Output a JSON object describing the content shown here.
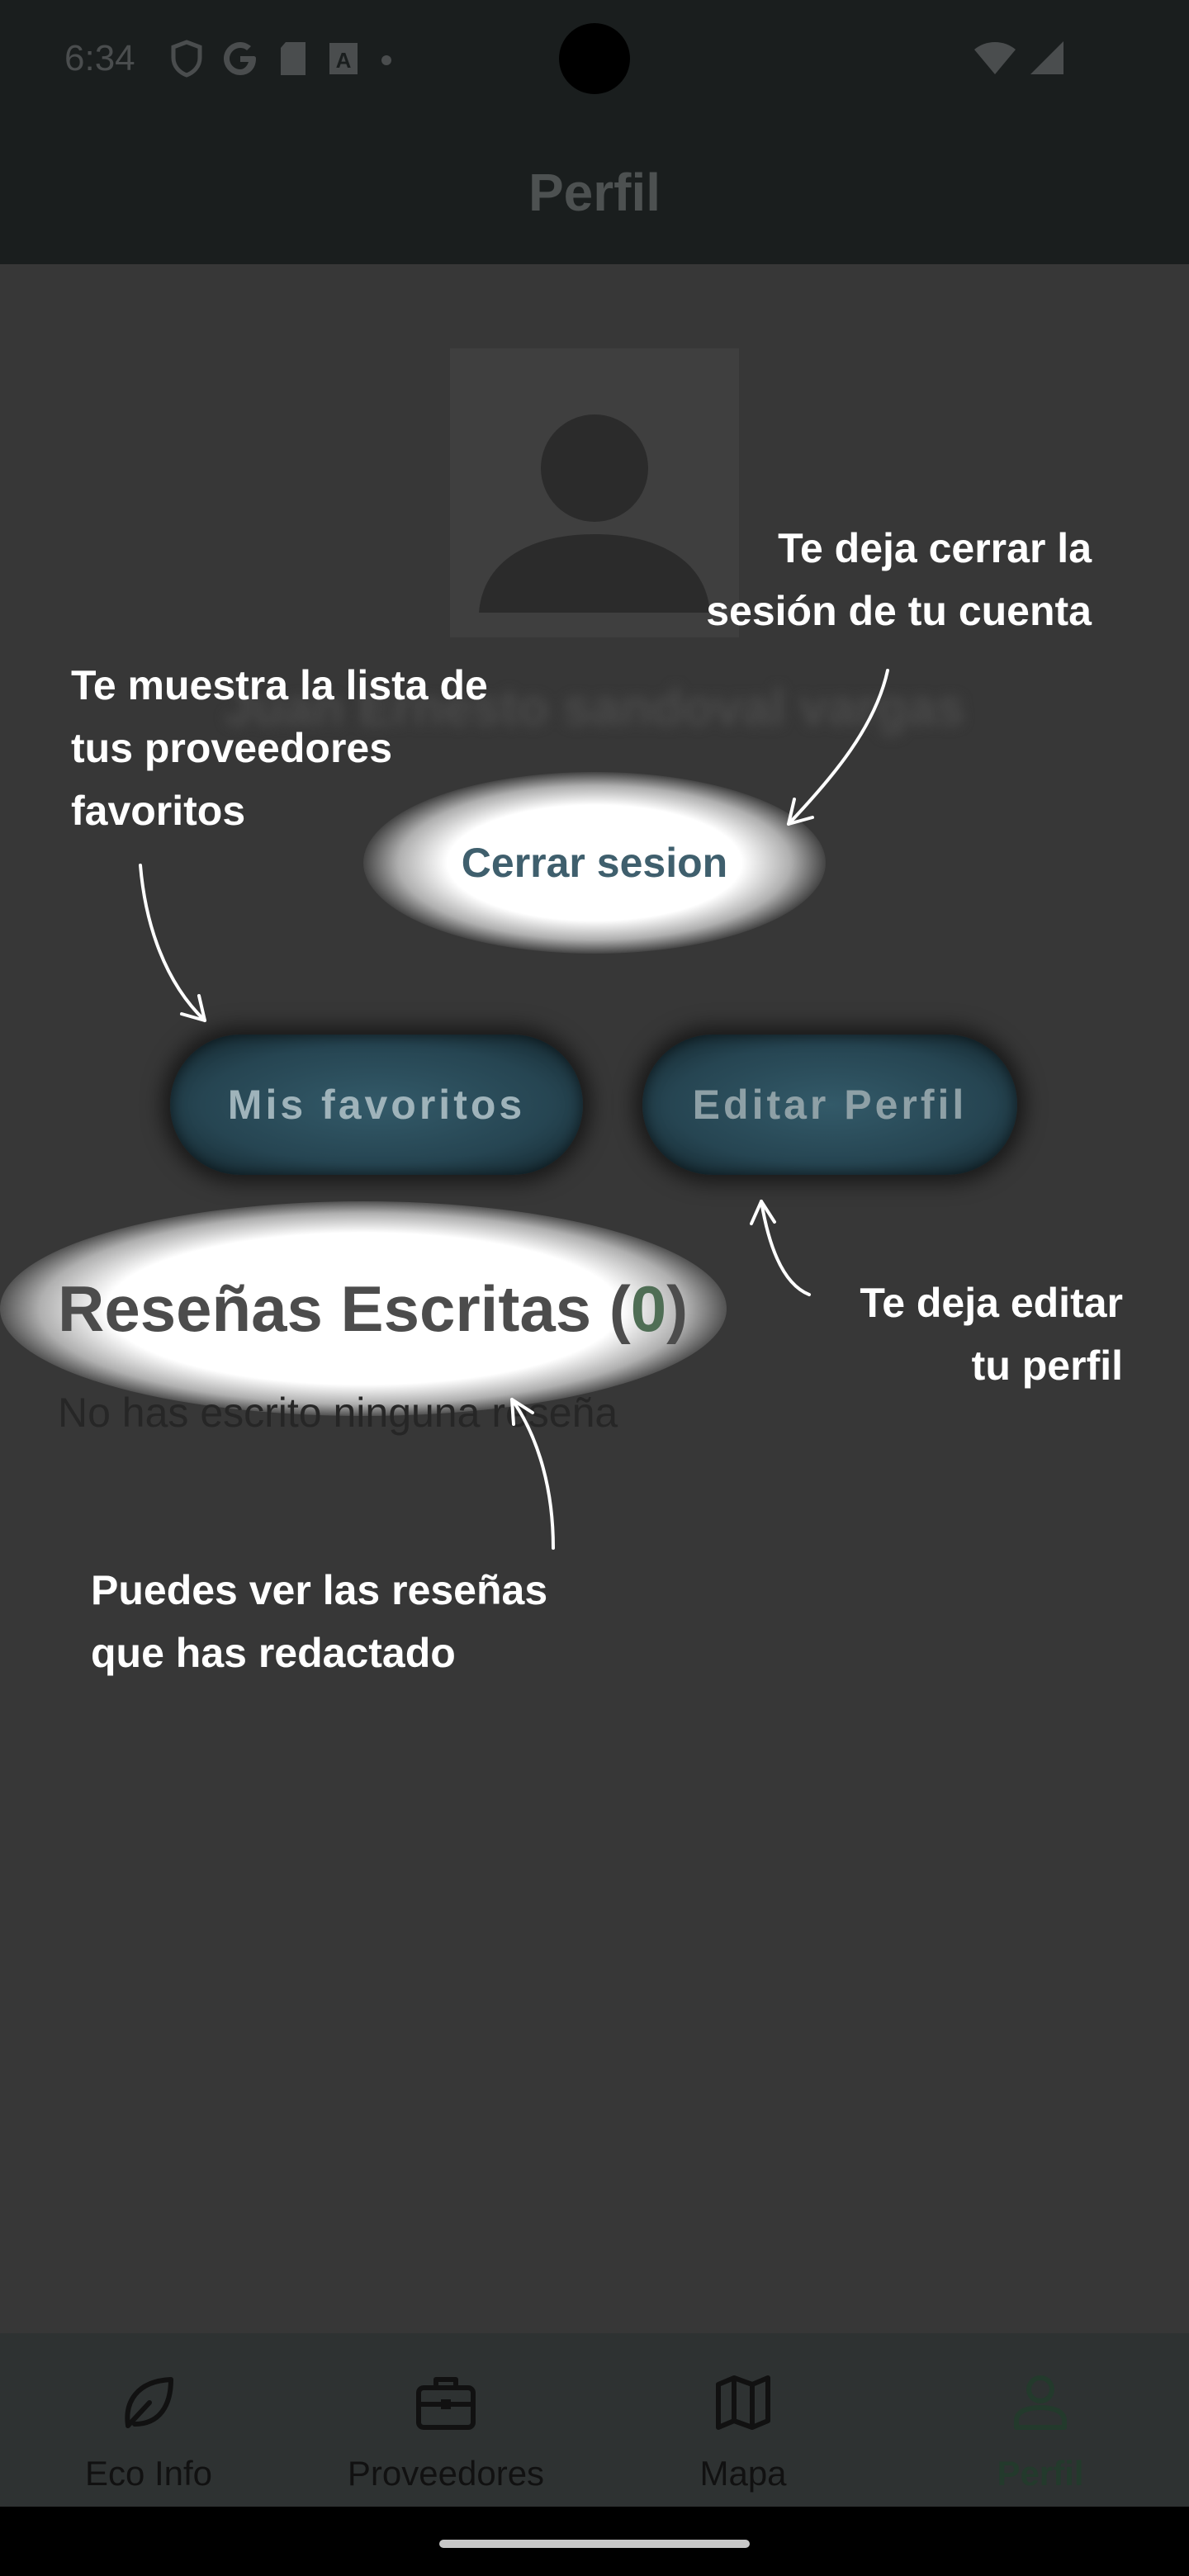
{
  "status_bar": {
    "time": "6:34"
  },
  "app_bar": {
    "title": "Perfil"
  },
  "profile": {
    "user_name": "Juan Ernesto sandoval vargas",
    "logout_label": "Cerrar sesion",
    "favorites_label": "Mis favoritos",
    "edit_label": "Editar Perfil"
  },
  "reviews": {
    "title": "Reseñas Escritas",
    "open_paren": "(",
    "count": "0",
    "close_paren": ")",
    "empty_text": "No has escrito ninguna reseña"
  },
  "tutorial": {
    "logout": {
      "line1": "Te deja cerrar la",
      "line2": "sesión de tu cuenta"
    },
    "favorites": {
      "line1": "Te muestra la lista de",
      "line2": "tus proveedores",
      "line3": "favoritos"
    },
    "edit": {
      "line1": "Te deja editar",
      "line2": "tu perfil"
    },
    "reviews": {
      "line1": "Puedes ver las reseñas",
      "line2": "que has redactado"
    }
  },
  "bottom_nav": {
    "items": [
      {
        "label": "Eco Info",
        "icon": "leaf-icon"
      },
      {
        "label": "Proveedores",
        "icon": "briefcase-icon"
      },
      {
        "label": "Mapa",
        "icon": "map-icon"
      },
      {
        "label": "Perfil",
        "icon": "person-icon"
      }
    ],
    "active": "Perfil"
  },
  "colors": {
    "overlay": "#373737",
    "app_bar": "#1a1e1e",
    "button": "#264552",
    "accent_green": "#233a2c"
  }
}
